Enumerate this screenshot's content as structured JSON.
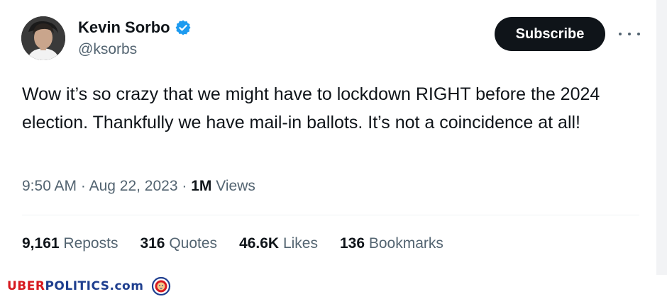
{
  "tweet": {
    "author_name": "Kevin Sorbo",
    "handle": "@ksorbs",
    "subscribe_label": "Subscribe",
    "text": "Wow it’s so crazy that we might have to lockdown RIGHT before the 2024 election. Thankfully we have mail-in ballots. It’s not a coincidence at all!",
    "time": "9:50 AM",
    "date": "Aug 22, 2023",
    "views_count": "1M",
    "views_label": "Views",
    "stats": [
      {
        "count": "9,161",
        "label": "Reposts"
      },
      {
        "count": "316",
        "label": "Quotes"
      },
      {
        "count": "46.6K",
        "label": "Likes"
      },
      {
        "count": "136",
        "label": "Bookmarks"
      }
    ],
    "icons": {
      "verified": "verified-badge-icon",
      "more": "more-options-icon"
    },
    "colors": {
      "verified": "#1d9bf0",
      "subscribe_bg": "#0f1419",
      "secondary_text": "#536471"
    }
  },
  "watermark": {
    "part1": "UBER",
    "part2": "POLITICS",
    "part3": ".com",
    "colors": {
      "red": "#d7191f",
      "blue": "#1f3f8f"
    }
  }
}
